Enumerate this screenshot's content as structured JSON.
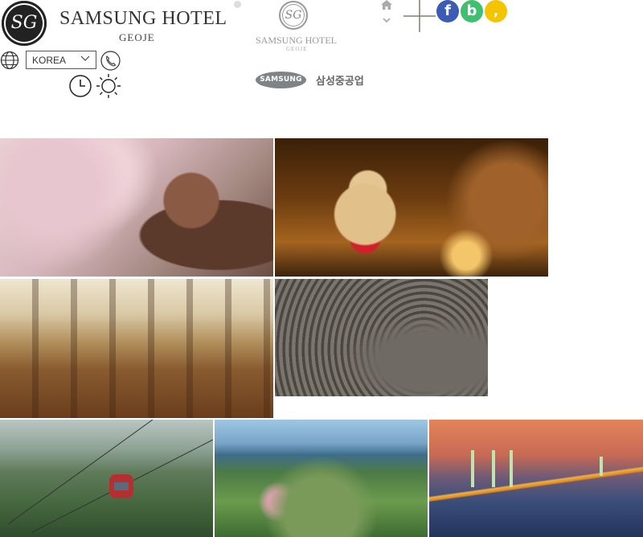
{
  "header": {
    "logo": {
      "seal_text": "SG",
      "name": "SAMSUNG HOTEL",
      "location": "GEOJE"
    },
    "logo_small": {
      "seal_text": "SG",
      "name": "SAMSUNG HOTEL",
      "location": "GEOJE"
    },
    "language_select": {
      "value": "KOREA"
    },
    "partner": {
      "badge": "SAMSUNG",
      "name": "삼성중공업"
    },
    "icons": [
      "globe-icon",
      "phone-icon",
      "clock-icon",
      "sun-icon",
      "home-icon",
      "chevron-down-icon",
      "plus-icon"
    ],
    "social": [
      {
        "label": "f",
        "color": "#3b5bb5"
      },
      {
        "label": "b",
        "color": "#3fbf70"
      },
      {
        "label": ",",
        "color": "#f5c400"
      }
    ]
  }
}
